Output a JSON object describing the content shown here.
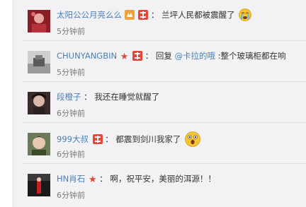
{
  "comments": [
    {
      "username": "太阳公公月亮么么",
      "separator": "：",
      "text": "兰坪人民都被震醒了",
      "time": "5分钟前",
      "badge": "vip-badge-icon",
      "emoji": "crying-emoji-icon"
    },
    {
      "username": "CHUNYANGBIN",
      "separator": "：",
      "reply_prefix": "回复",
      "mention": "@卡拉的哦",
      "text": ":整个玻璃柜都在响",
      "time": "5分钟前",
      "badge": "vip-badge-icon",
      "star": "★"
    },
    {
      "username": "段橙子",
      "separator": "：",
      "text": "我还在睡觉就醒了",
      "time": "6分钟前"
    },
    {
      "username": "999大叔",
      "separator": "：",
      "text": "都震到剑川我家了",
      "time": "6分钟前",
      "badge": "vip-badge-icon",
      "emoji": "shocked-emoji-icon"
    },
    {
      "username": "HN肖石",
      "separator": "：",
      "text": "啊，祝平安，美丽的洱源！！",
      "time": "6分钟前",
      "star": "★"
    }
  ],
  "colors": {
    "username": "#4a7fb6",
    "text": "#333333",
    "time": "#7a7a7a",
    "badge": "#e2473a",
    "background": "#f2f2f5"
  }
}
